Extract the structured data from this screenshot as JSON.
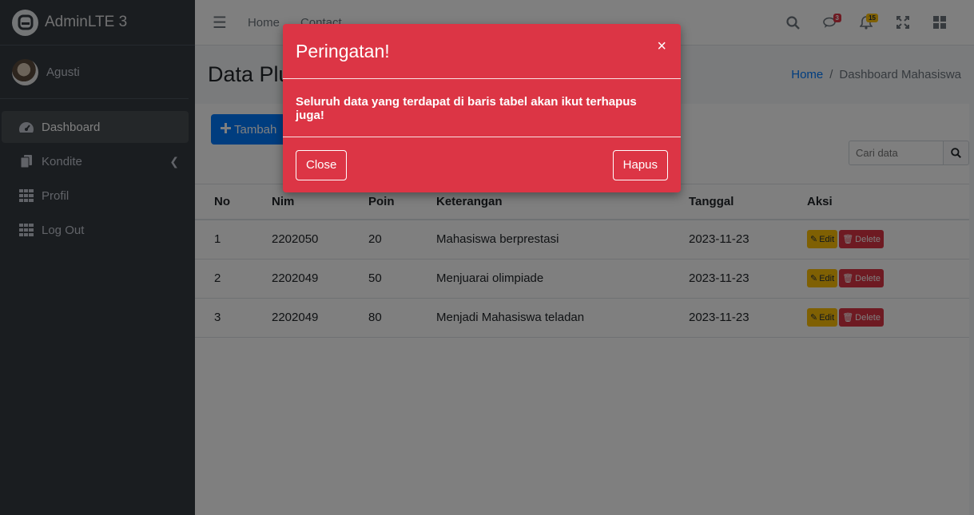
{
  "brand": {
    "name": "AdminLTE 3"
  },
  "user": {
    "name": "Agusti"
  },
  "sidebar": {
    "items": [
      {
        "label": "Dashboard",
        "icon": "tachometer-icon",
        "active": true
      },
      {
        "label": "Kondite",
        "icon": "copy-icon",
        "has_children": true
      },
      {
        "label": "Profil",
        "icon": "grid-icon"
      },
      {
        "label": "Log Out",
        "icon": "grid-icon"
      }
    ]
  },
  "topbar": {
    "links": [
      "Home",
      "Contact"
    ],
    "messages_badge": "3",
    "notifications_badge": "15"
  },
  "header": {
    "title": "Data Plu",
    "breadcrumb": [
      "Home",
      "Dashboard Mahasiswa"
    ]
  },
  "card": {
    "add_button": "Tambah",
    "search_placeholder": "Cari data"
  },
  "table": {
    "columns": [
      "No",
      "Nim",
      "Poin",
      "Keterangan",
      "Tanggal",
      "Aksi"
    ],
    "rows": [
      {
        "no": "1",
        "nim": "2202050",
        "poin": "20",
        "keterangan": "Mahasiswa berprestasi",
        "tanggal": "2023-11-23"
      },
      {
        "no": "2",
        "nim": "2202049",
        "poin": "50",
        "keterangan": "Menjuarai olimpiade",
        "tanggal": "2023-11-23"
      },
      {
        "no": "3",
        "nim": "2202049",
        "poin": "80",
        "keterangan": "Menjadi Mahasiswa teladan",
        "tanggal": "2023-11-23"
      }
    ],
    "edit_label": "Edit",
    "delete_label": "Delete"
  },
  "modal": {
    "title": "Peringatan!",
    "close_symbol": "×",
    "message": "Seluruh data yang terdapat di baris tabel akan ikut terhapus juga!",
    "close_button": "Close",
    "confirm_button": "Hapus"
  },
  "colors": {
    "primary": "#007bff",
    "danger": "#dc3545",
    "warning": "#ffc107",
    "sidebar": "#343a40"
  }
}
